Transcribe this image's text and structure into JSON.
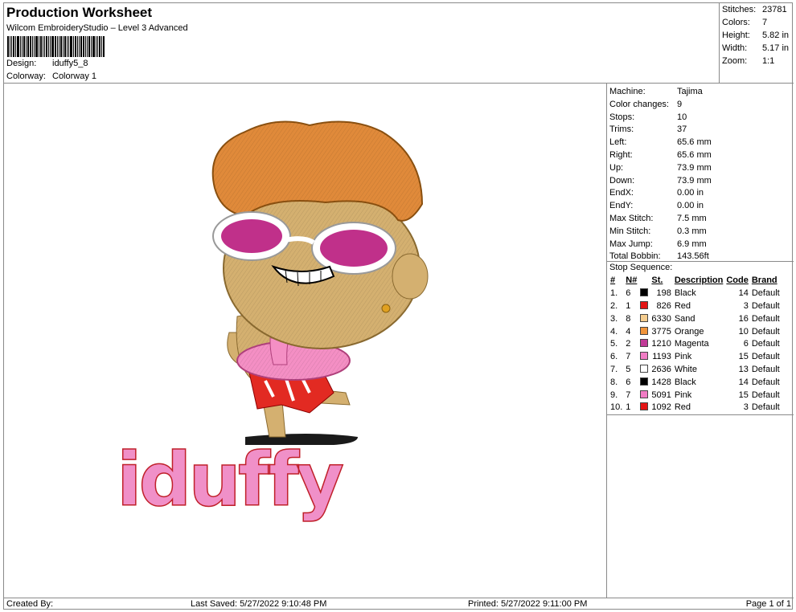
{
  "header": {
    "title": "Production Worksheet",
    "software": "Wilcom EmbroideryStudio – Level 3 Advanced",
    "design_label": "Design:",
    "design_value": "iduffy5_8",
    "colorway_label": "Colorway:",
    "colorway_value": "Colorway 1"
  },
  "summary": {
    "stitches_label": "Stitches:",
    "stitches": "23781",
    "colors_label": "Colors:",
    "colors": "7",
    "height_label": "Height:",
    "height": "5.82 in",
    "width_label": "Width:",
    "width": "5.17 in",
    "zoom_label": "Zoom:",
    "zoom": "1:1"
  },
  "machine_info": [
    {
      "label": "Machine:",
      "value": "Tajima"
    },
    {
      "label": "Color changes:",
      "value": "9"
    },
    {
      "label": "Stops:",
      "value": "10"
    },
    {
      "label": "Trims:",
      "value": "37"
    },
    {
      "label": "Left:",
      "value": "65.6 mm"
    },
    {
      "label": "Right:",
      "value": "65.6 mm"
    },
    {
      "label": "Up:",
      "value": "73.9 mm"
    },
    {
      "label": "Down:",
      "value": "73.9 mm"
    },
    {
      "label": "EndX:",
      "value": "0.00 in"
    },
    {
      "label": "EndY:",
      "value": "0.00 in"
    },
    {
      "label": "Max Stitch:",
      "value": "7.5 mm"
    },
    {
      "label": "Min Stitch:",
      "value": "0.3 mm"
    },
    {
      "label": "Max Jump:",
      "value": "6.9 mm"
    },
    {
      "label": "Total Bobbin:",
      "value": "143.56ft"
    }
  ],
  "stop_sequence": {
    "title": "Stop Sequence:",
    "headers": [
      "#",
      "N#",
      "St.",
      "Description",
      "Code",
      "Brand"
    ],
    "rows": [
      {
        "num": "1.",
        "n": "6",
        "color": "#000000",
        "st": "198",
        "desc": "Black",
        "code": "14",
        "brand": "Default"
      },
      {
        "num": "2.",
        "n": "1",
        "color": "#e41414",
        "st": "826",
        "desc": "Red",
        "code": "3",
        "brand": "Default"
      },
      {
        "num": "3.",
        "n": "8",
        "color": "#f4cc8e",
        "st": "6330",
        "desc": "Sand",
        "code": "16",
        "brand": "Default"
      },
      {
        "num": "4.",
        "n": "4",
        "color": "#f0943a",
        "st": "3775",
        "desc": "Orange",
        "code": "10",
        "brand": "Default"
      },
      {
        "num": "5.",
        "n": "2",
        "color": "#c03a96",
        "st": "1210",
        "desc": "Magenta",
        "code": "6",
        "brand": "Default"
      },
      {
        "num": "6.",
        "n": "7",
        "color": "#f07cc4",
        "st": "1193",
        "desc": "Pink",
        "code": "15",
        "brand": "Default"
      },
      {
        "num": "7.",
        "n": "5",
        "color": "#ffffff",
        "st": "2636",
        "desc": "White",
        "code": "13",
        "brand": "Default"
      },
      {
        "num": "8.",
        "n": "6",
        "color": "#000000",
        "st": "1428",
        "desc": "Black",
        "code": "14",
        "brand": "Default"
      },
      {
        "num": "9.",
        "n": "7",
        "color": "#f07cc4",
        "st": "5091",
        "desc": "Pink",
        "code": "15",
        "brand": "Default"
      },
      {
        "num": "10.",
        "n": "1",
        "color": "#e41414",
        "st": "1092",
        "desc": "Red",
        "code": "3",
        "brand": "Default"
      }
    ]
  },
  "design_text": "iduffy",
  "footer": {
    "created": "Created By:",
    "saved": "Last Saved: 5/27/2022 9:10:48 PM",
    "printed": "Printed: 5/27/2022 9:11:00 PM",
    "page": "Page 1 of 1"
  }
}
